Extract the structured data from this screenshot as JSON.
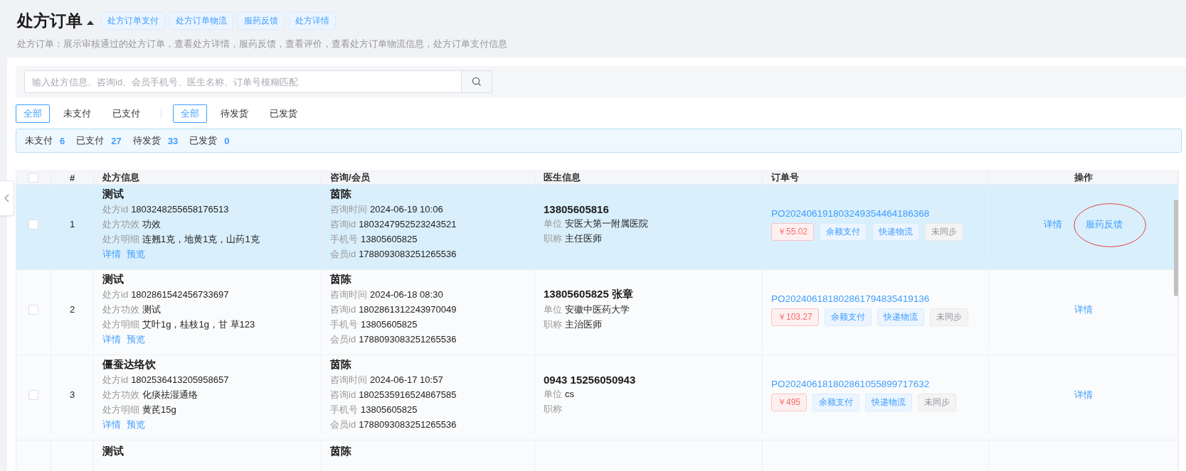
{
  "header": {
    "title": "处方订单",
    "tabs": [
      "处方订单支付",
      "处方订单物流",
      "服药反馈",
      "处方详情"
    ],
    "description": "处方订单：展示审核通过的处方订单，查看处方详情，服药反馈，查看评价，查看处方订单物流信息，处方订单支付信息"
  },
  "search": {
    "placeholder": "输入处方信息、咨询id、会员手机号、医生名称、订单号模糊匹配"
  },
  "filters": [
    [
      {
        "label": "全部",
        "selected": true
      },
      {
        "label": "未支付",
        "selected": false
      },
      {
        "label": "已支付",
        "selected": false
      }
    ],
    [
      {
        "label": "全部",
        "selected": true
      },
      {
        "label": "待发货",
        "selected": false
      },
      {
        "label": "已发货",
        "selected": false
      }
    ]
  ],
  "summary": [
    {
      "label": "未支付",
      "count": "6"
    },
    {
      "label": "已支付",
      "count": "27"
    },
    {
      "label": "待发货",
      "count": "33"
    },
    {
      "label": "已发货",
      "count": "0"
    }
  ],
  "table": {
    "select_all": false,
    "columns": [
      "#",
      "处方信息",
      "咨询/会员",
      "医生信息",
      "订单号",
      "操作"
    ],
    "rows": [
      {
        "selected": true,
        "checked": false,
        "index": "1",
        "prescription": {
          "name": "测试",
          "fields": [
            {
              "label": "处方id",
              "value": "1803248255658176513"
            },
            {
              "label": "处方功效",
              "value": "功效"
            },
            {
              "label": "处方明细",
              "value": "连翘1克，地黄1克，山药1克"
            }
          ],
          "links": [
            "详情",
            "预览"
          ]
        },
        "consult": {
          "name": "茵陈",
          "fields": [
            {
              "label": "咨询时间",
              "value": "2024-06-19 10:06"
            },
            {
              "label": "咨询id",
              "value": "1803247952523243521"
            },
            {
              "label": "手机号",
              "value": "13805605825"
            },
            {
              "label": "会员id",
              "value": "1788093083251265536"
            }
          ]
        },
        "doctor": {
          "name": "13805605816",
          "fields": [
            {
              "label": "单位",
              "value": "安医大第一附属医院"
            },
            {
              "label": "职称",
              "value": "主任医师"
            }
          ]
        },
        "order": {
          "number": "PO202406191803249354464186368",
          "tags": [
            {
              "kind": "price",
              "text": "￥55.02"
            },
            {
              "kind": "info",
              "text": "余额支付"
            },
            {
              "kind": "info",
              "text": "快递物流"
            },
            {
              "kind": "muted",
              "text": "未同步"
            }
          ]
        },
        "actions": [
          "详情",
          "服药反馈"
        ],
        "circled": true
      },
      {
        "selected": false,
        "checked": false,
        "index": "2",
        "prescription": {
          "name": "测试",
          "fields": [
            {
              "label": "处方id",
              "value": "1802861542456733697"
            },
            {
              "label": "处方功效",
              "value": "测试"
            },
            {
              "label": "处方明细",
              "value": "艾叶1g，桂枝1g，甘 草123"
            }
          ],
          "links": [
            "详情",
            "预览"
          ]
        },
        "consult": {
          "name": "茵陈",
          "fields": [
            {
              "label": "咨询时间",
              "value": "2024-06-18 08:30"
            },
            {
              "label": "咨询id",
              "value": "1802861312243970049"
            },
            {
              "label": "手机号",
              "value": "13805605825"
            },
            {
              "label": "会员id",
              "value": "1788093083251265536"
            }
          ]
        },
        "doctor": {
          "name": "13805605825 张章",
          "fields": [
            {
              "label": "单位",
              "value": "安徽中医药大学"
            },
            {
              "label": "职称",
              "value": "主治医师"
            }
          ]
        },
        "order": {
          "number": "PO202406181802861794835419136",
          "tags": [
            {
              "kind": "price",
              "text": "￥103.27"
            },
            {
              "kind": "info",
              "text": "余额支付"
            },
            {
              "kind": "info",
              "text": "快递物流"
            },
            {
              "kind": "muted",
              "text": "未同步"
            }
          ]
        },
        "actions": [
          "详情"
        ],
        "circled": false
      },
      {
        "selected": false,
        "checked": false,
        "index": "3",
        "prescription": {
          "name": "僵蚕达络饮",
          "fields": [
            {
              "label": "处方id",
              "value": "1802536413205958657"
            },
            {
              "label": "处方功效",
              "value": "化痰祛湿通络"
            },
            {
              "label": "处方明细",
              "value": "黄芪15g"
            }
          ],
          "links": [
            "详情",
            "预览"
          ]
        },
        "consult": {
          "name": "茵陈",
          "fields": [
            {
              "label": "咨询时间",
              "value": "2024-06-17 10:57"
            },
            {
              "label": "咨询id",
              "value": "1802535916524867585"
            },
            {
              "label": "手机号",
              "value": "13805605825"
            },
            {
              "label": "会员id",
              "value": "1788093083251265536"
            }
          ]
        },
        "doctor": {
          "name": "0943 15256050943",
          "fields": [
            {
              "label": "单位",
              "value": "cs"
            },
            {
              "label": "职称"
            }
          ]
        },
        "order": {
          "number": "PO202406181802861055899717632",
          "tags": [
            {
              "kind": "price",
              "text": "￥495"
            },
            {
              "kind": "info",
              "text": "余额支付"
            },
            {
              "kind": "info",
              "text": "快递物流"
            },
            {
              "kind": "muted",
              "text": "未同步"
            }
          ]
        },
        "actions": [
          "详情"
        ],
        "circled": false
      }
    ],
    "partial_row": {
      "prescription_name": "测试",
      "consult_name": "茵陈"
    }
  }
}
